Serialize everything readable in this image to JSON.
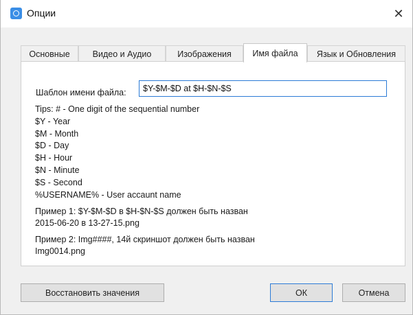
{
  "window": {
    "title": "Опции",
    "close_glyph": "✕"
  },
  "tabs": [
    {
      "label": "Основные",
      "active": false
    },
    {
      "label": "Видео и Аудио",
      "active": false
    },
    {
      "label": "Изображения",
      "active": false
    },
    {
      "label": "Имя файла",
      "active": true
    },
    {
      "label": "Язык и Обновления",
      "active": false
    }
  ],
  "filename": {
    "template_label": "Шаблон имени файла:",
    "template_value": "$Y-$M-$D at $H-$N-$S",
    "tips": [
      "Tips: # - One digit of the sequential number",
      "$Y - Year",
      "$M - Month",
      "$D - Day",
      "$H - Hour",
      "$N - Minute",
      "$S - Second",
      "%USERNAME% - User accaunt name"
    ],
    "example1_line1": "Пример 1: $Y-$M-$D в $H-$N-$S должен быть назван",
    "example1_line2": "2015-06-20 в 13-27-15.png",
    "example2_line1": "Пример 2: Img####, 14й скриншот должен быть назван",
    "example2_line2": "Img0014.png"
  },
  "buttons": {
    "restore": "Восстановить значения",
    "ok": "ОК",
    "cancel": "Отмена"
  },
  "colors": {
    "accent": "#2b7bd6",
    "app_icon": "#3a8ee6"
  },
  "icons": {
    "app": "app-icon",
    "close": "close-icon"
  }
}
